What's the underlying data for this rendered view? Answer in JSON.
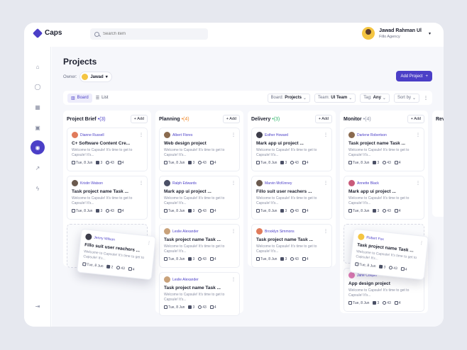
{
  "app": {
    "name": "Caps"
  },
  "search": {
    "placeholder": "Search item"
  },
  "user": {
    "name": "Jawad Rahman Ul",
    "org": "Fillo Agency"
  },
  "page": {
    "title": "Projects",
    "owner_label": "Owner:",
    "owner_value": "Jawad",
    "add_project_label": "Add Project"
  },
  "toolbar": {
    "board_label": "Board",
    "list_label": "List",
    "board_select_prefix": "Board:",
    "board_select_value": "Projects",
    "team_prefix": "Team:",
    "team_value": "UI Team",
    "tag_prefix": "Tag:",
    "tag_value": "Any",
    "sort_label": "Sort by"
  },
  "colors": {
    "accent": "#4b3fc7",
    "brief": "#4b3fc7",
    "planning": "#f08a2e",
    "delivery": "#2fb56b",
    "monitor": "#8a8fa3"
  },
  "columns": [
    {
      "title": "Project Brief",
      "count": "(3)",
      "add": "Add",
      "cards": [
        {
          "assignee": "Dianne Russell",
          "title": "C+ Software Content Cre...",
          "desc": "Welcome to Capsule! It's time to get to Capsule! It's...",
          "date": "Tue, 8 Jun",
          "checks": "3",
          "comments": "43",
          "files": "4",
          "avatar": "#e07b5b"
        },
        {
          "assignee": "Kristin Watson",
          "title": "Task project name Task ...",
          "desc": "Welcome to Capsule! It's time to get to Capsule! It's...",
          "date": "Tue, 8 Jun",
          "checks": "3",
          "comments": "43",
          "files": "4",
          "avatar": "#6b5a4e"
        }
      ],
      "dragging": {
        "assignee": "Jenny Wilson",
        "title": "Fillo suit user reachers ...",
        "desc": "Welcome to Capsule! It's time to get to Capsule! It's...",
        "date": "Tue, 8 Jun",
        "checks": "2",
        "comments": "43",
        "files": "4",
        "avatar": "#3d3d4a"
      }
    },
    {
      "title": "Planning",
      "count": "(4)",
      "add": "Add",
      "cards": [
        {
          "assignee": "Albert Flores",
          "title": "Web design project",
          "desc": "Welcome to Capsule! It's time to get to Capsule! It's...",
          "date": "Tue, 8 Jun",
          "checks": "3",
          "comments": "43",
          "files": "4",
          "avatar": "#8a6a4e"
        },
        {
          "assignee": "Ralph Edwards",
          "title": "Mark app ui project ...",
          "desc": "Welcome to Capsule! It's time to get to Capsule! It's...",
          "date": "Tue, 8 Jun",
          "checks": "3",
          "comments": "43",
          "files": "4",
          "avatar": "#4b5066"
        },
        {
          "assignee": "Leslie Alexander",
          "title": "Task project name Task ...",
          "desc": "Welcome to Capsule! It's time to get to Capsule! It's...",
          "date": "Tue, 8 Jun",
          "checks": "3",
          "comments": "43",
          "files": "4",
          "avatar": "#c9a27a"
        },
        {
          "assignee": "Leslie Alexander",
          "title": "Task project name Task ...",
          "desc": "Welcome to Capsule! It's time to get to Capsule! It's...",
          "date": "Tue, 8 Jun",
          "checks": "3",
          "comments": "43",
          "files": "4",
          "avatar": "#c9a27a"
        }
      ]
    },
    {
      "title": "Delivery",
      "count": "(3)",
      "add": "Add",
      "cards": [
        {
          "assignee": "Esther Howard",
          "title": "Mark app ui project ...",
          "desc": "Welcome to Capsule! It's time to get to Capsule! It's...",
          "date": "Tue, 8 Jun",
          "checks": "3",
          "comments": "43",
          "files": "4",
          "avatar": "#3d3d4a"
        },
        {
          "assignee": "Marvin McKinney",
          "title": "Fillo suit user reachers ...",
          "desc": "Welcome to Capsule! It's time to get to Capsule! It's...",
          "date": "Tue, 8 Jun",
          "checks": "3",
          "comments": "43",
          "files": "4",
          "avatar": "#6b5a4e"
        },
        {
          "assignee": "Brooklyn Simmons",
          "title": "Task project name Task ...",
          "desc": "Welcome to Capsule! It's time to get to Capsule! It's...",
          "date": "Tue, 8 Jun",
          "checks": "3",
          "comments": "43",
          "files": "4",
          "avatar": "#e07b5b"
        }
      ]
    },
    {
      "title": "Monitor",
      "count": "(4)",
      "add": "Add",
      "cards": [
        {
          "assignee": "Darlene Robertson",
          "title": "Task project name Task ...",
          "desc": "Welcome to Capsule! It's time to get to Capsule! It's...",
          "date": "Tue, 8 Jun",
          "checks": "3",
          "comments": "43",
          "files": "4",
          "avatar": "#8a6a4e"
        },
        {
          "assignee": "Annette Black",
          "title": "Mark app ui project ...",
          "desc": "Welcome to Capsule! It's time to get to Capsule! It's...",
          "date": "Tue, 8 Jun",
          "checks": "3",
          "comments": "43",
          "files": "4",
          "avatar": "#c95b7a"
        }
      ],
      "dragging": {
        "assignee": "Robert Fox",
        "title": "Task project name Task ...",
        "desc": "Welcome to Capsule! It's time to get to Capsule! It's...",
        "date": "Tue, 8 Jun",
        "checks": "3",
        "comments": "43",
        "files": "4",
        "avatar": "#f4c542"
      },
      "last": {
        "assignee": "Jane Cooper",
        "title": "App design project",
        "desc": "Welcome to Capsule! It's time to get to Capsule! It's...",
        "date": "Tue, 8 Jun",
        "checks": "3",
        "comments": "43",
        "files": "4",
        "avatar": "#e07bb5"
      }
    },
    {
      "title": "Rev"
    }
  ]
}
